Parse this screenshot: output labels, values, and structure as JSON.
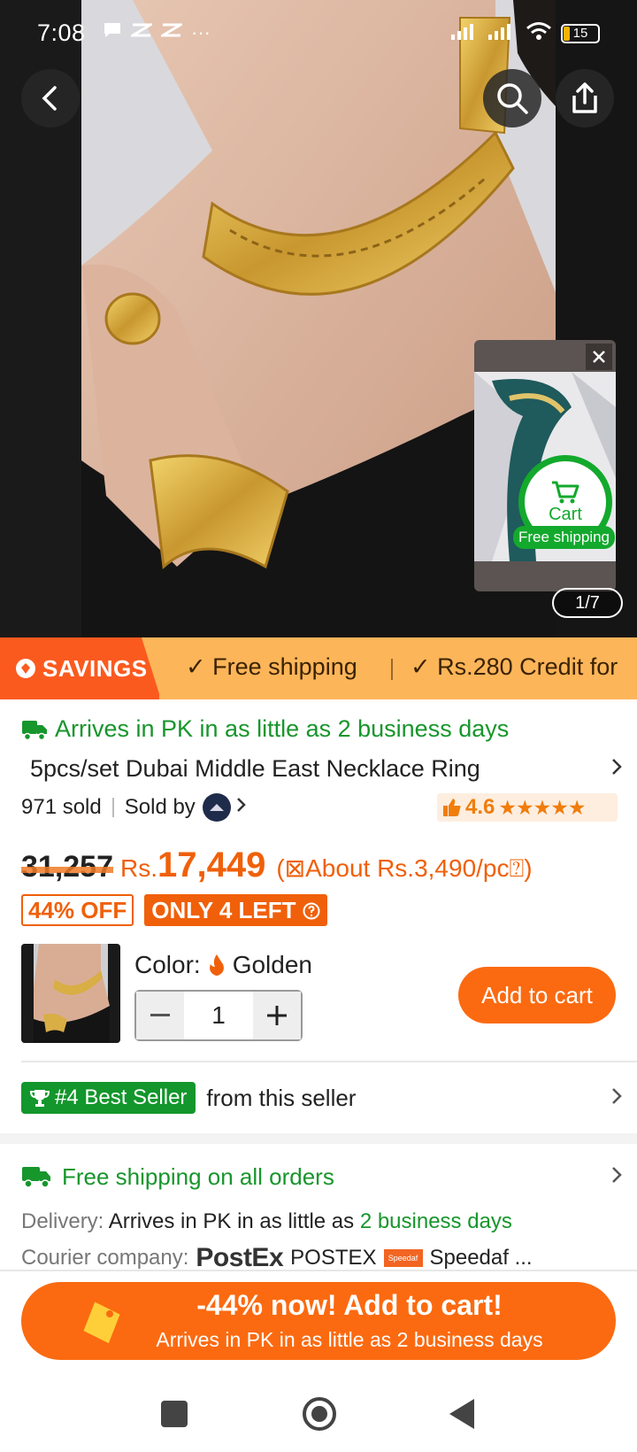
{
  "status_bar": {
    "time": "7:08",
    "notification_icons": [
      "chat-bubble-icon",
      "app-icon",
      "app-icon",
      "more-dots-icon"
    ],
    "more_dots": "···",
    "battery": "15"
  },
  "hero": {
    "image_counter": "1/7",
    "mini_video": {
      "cart_label": "Cart",
      "free_shipping": "Free shipping"
    }
  },
  "savings_strip": {
    "tag": "SAVINGS",
    "items": [
      "✓ Free shipping",
      "✓ Rs.280 Credit for"
    ]
  },
  "product": {
    "arrival": "Arrives in PK in as little as 2 business days",
    "title": "5pcs/set Dubai Middle East Necklace Ring",
    "sold": "971 sold",
    "sold_by": "Sold by",
    "rating": "4.6",
    "old_price": "31,257",
    "currency": "Rs.",
    "price": "17,449",
    "about_price": "(⊠About Rs.3,490/pc⍰)",
    "discount": "44% OFF",
    "stock": "ONLY 4 LEFT",
    "color_label": "Color:",
    "color_value": "Golden",
    "quantity": "1",
    "add_to_cart": "Add to cart"
  },
  "best_seller": {
    "badge": "#4 Best Seller",
    "text": "from this seller"
  },
  "shipping": {
    "title": "Free shipping on all orders",
    "delivery_key": "Delivery:",
    "delivery_text": "Arrives in PK in as little as",
    "delivery_days": "2 business days",
    "courier_key": "Courier company:",
    "courier_logo": "PostEx",
    "courier_name": "POSTEX",
    "courier_more": "Speedaf ..."
  },
  "cta": {
    "main": "-44% now! Add to cart!",
    "sub": "Arrives in PK in as little as 2 business days"
  },
  "colors": {
    "accent_orange": "#fb6a10",
    "price_orange": "#f0600a",
    "green": "#17962c",
    "savings_bg": "#fdb55a"
  }
}
